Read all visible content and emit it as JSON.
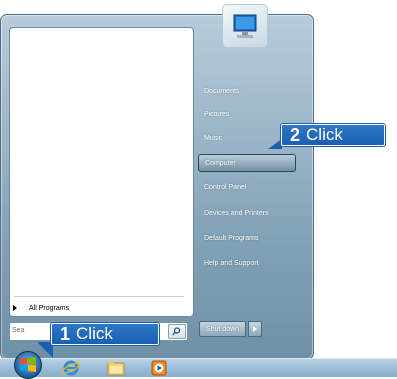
{
  "start_menu": {
    "all_programs_label": "All Programs",
    "search_placeholder": "Sea",
    "right_items": [
      {
        "label": "Documents"
      },
      {
        "label": "Pictures"
      },
      {
        "label": "Music"
      },
      {
        "label": "Computer"
      },
      {
        "label": "Control Panel"
      },
      {
        "label": "Devices and Printers"
      },
      {
        "label": "Default Programs"
      },
      {
        "label": "Help and Support"
      }
    ],
    "shutdown_label": "Shut down",
    "highlighted_item": "Computer"
  },
  "callouts": [
    {
      "number": "1",
      "text": "Click"
    },
    {
      "number": "2",
      "text": "Click"
    }
  ],
  "icons": [
    "user-picture-icon",
    "search-icon",
    "start-orb-icon",
    "internet-explorer-icon",
    "file-explorer-icon",
    "media-player-icon",
    "shutdown-arrow-icon"
  ],
  "colors": {
    "callout": "#1b5fb0",
    "highlight_border": "#29465e"
  }
}
